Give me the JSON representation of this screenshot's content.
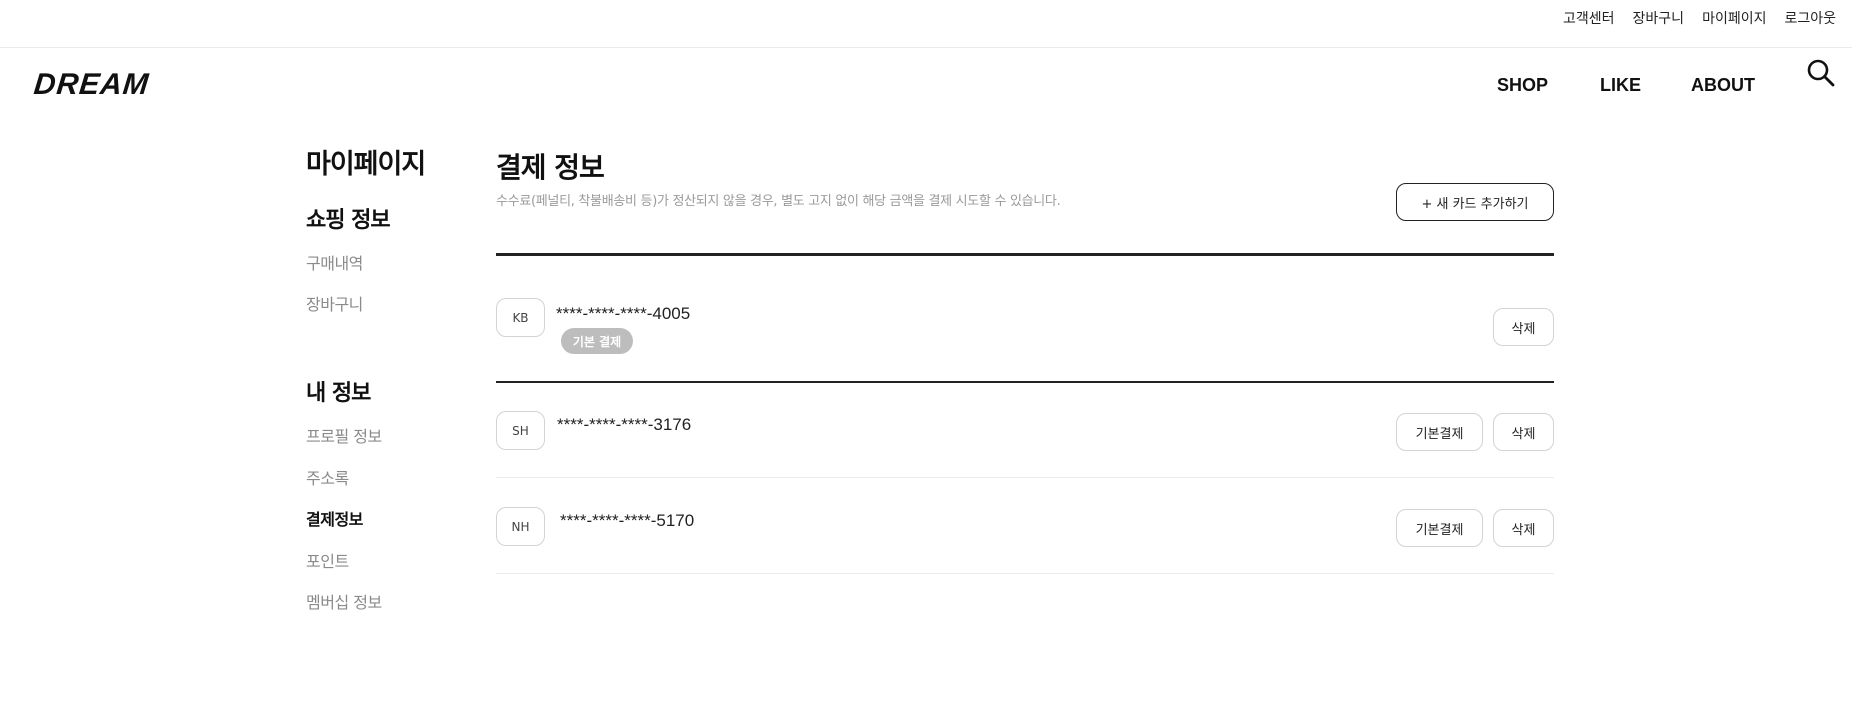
{
  "top_links": [
    "고객센터",
    "장바구니",
    "마이페이지",
    "로그아웃"
  ],
  "header": {
    "logo": "DREAM",
    "nav": {
      "shop": "SHOP",
      "like": "LIKE",
      "about": "ABOUT"
    },
    "search_icon": "search-icon"
  },
  "sidebar": {
    "title": "마이페이지",
    "groups": [
      {
        "title": "쇼핑 정보",
        "items": [
          "구매내역",
          "장바구니"
        ]
      },
      {
        "title": "내 정보",
        "items": [
          "프로필 정보",
          "주소록",
          "결제정보",
          "포인트",
          "멤버십 정보"
        ]
      }
    ],
    "active_item": "결제정보"
  },
  "content": {
    "title": "결제 정보",
    "description": "수수료(페널티, 착불배송비 등)가 정산되지 않을 경우, 별도 고지 없이 해당 금액을 결제 시도할 수 있습니다.",
    "add_card_label": "+ 새 카드 추가하기",
    "default_tag_label": "기본 결제",
    "set_default_label": "기본결제",
    "delete_label": "삭제",
    "cards": [
      {
        "bank": "KB",
        "number": "****-****-****-4005",
        "is_default": true
      },
      {
        "bank": "SH",
        "number": "****-****-****-3176",
        "is_default": false
      },
      {
        "bank": "NH",
        "number": "****-****-****-5170",
        "is_default": false
      }
    ]
  },
  "colors": {
    "text_primary": "#222222",
    "text_muted": "#8b8b8b",
    "border": "#d3d3d3",
    "divider": "#ebebeb",
    "default_tag_bg": "#bdbdbd"
  }
}
